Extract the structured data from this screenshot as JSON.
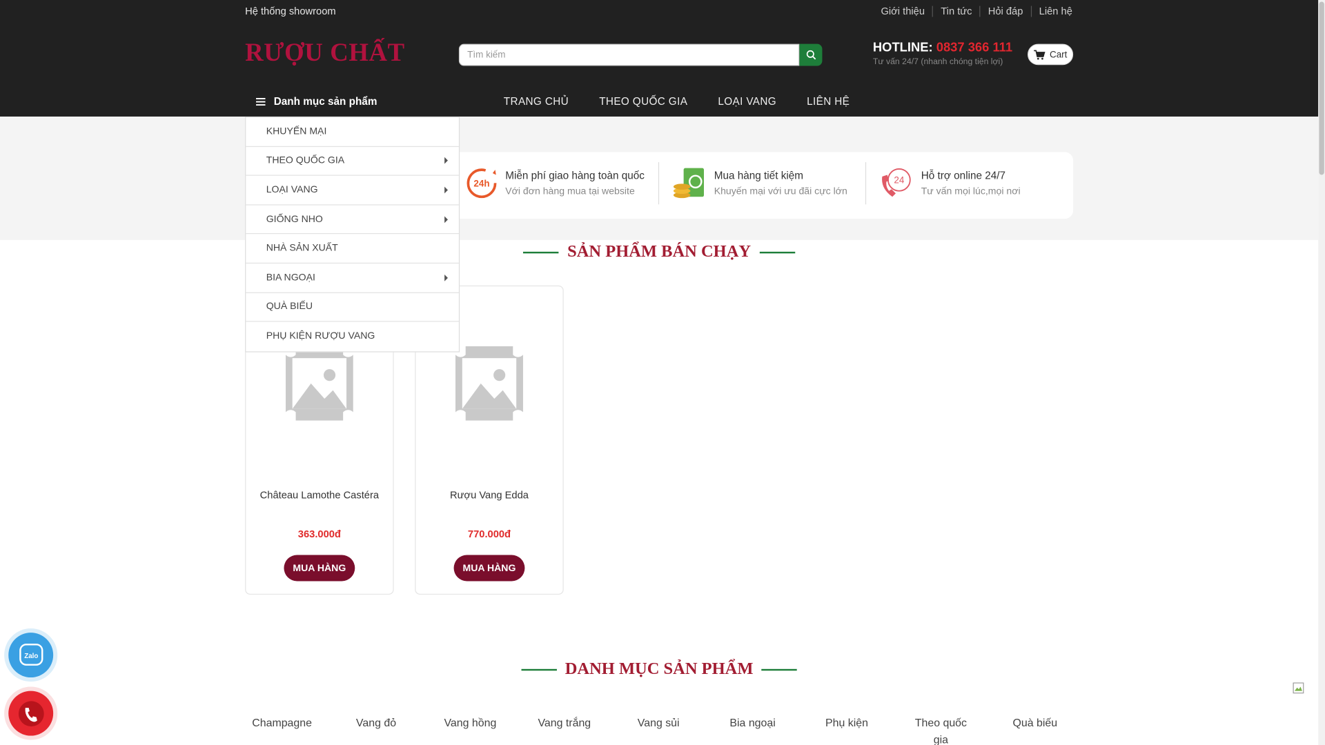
{
  "topbar": {
    "left_link": "Hệ thống showroom",
    "links": [
      "Giới thiệu",
      "Tin tức",
      "Hỏi đáp",
      "Liên hệ"
    ]
  },
  "header": {
    "logo": "RƯỢU CHẤT",
    "search_placeholder": "Tìm kiếm",
    "hotline_label": "HOTLINE:",
    "hotline_number": "0837 366 111",
    "hotline_sub": "Tư vấn 24/7 (nhanh chóng tiện lợi)",
    "cart_label": "Cart"
  },
  "nav": {
    "category_button": "Danh mục sản phẩm",
    "items": [
      "TRANG CHỦ",
      "THEO QUỐC GIA",
      "LOẠI VANG",
      "LIÊN HỆ"
    ]
  },
  "category_dropdown": [
    {
      "label": "KHUYẾN MẠI",
      "has_sub": false
    },
    {
      "label": "THEO QUỐC GIA",
      "has_sub": true
    },
    {
      "label": "LOẠI VANG",
      "has_sub": true
    },
    {
      "label": "GIỐNG NHO",
      "has_sub": true
    },
    {
      "label": "NHÀ SẢN XUẤT",
      "has_sub": false
    },
    {
      "label": "BIA NGOẠI",
      "has_sub": true
    },
    {
      "label": "QUÀ BIẾU",
      "has_sub": false
    },
    {
      "label": "PHỤ KIỆN RƯỢU VANG",
      "has_sub": false
    }
  ],
  "features": [
    {
      "title": "Miễn phí giao hàng toàn quốc",
      "subtitle": "Với đơn hàng mua tại website",
      "icon": "delivery-24h-icon"
    },
    {
      "title": "Mua hàng tiết kiệm",
      "subtitle": "Khuyến mại với ưu đãi cực lớn",
      "icon": "money-coins-icon"
    },
    {
      "title": "Hỗ trợ online 24/7",
      "subtitle": "Tư vấn mọi lúc,mọi nơi",
      "icon": "phone-24-icon"
    }
  ],
  "bestseller": {
    "title": "SẢN PHẨM BÁN CHẠY",
    "products": [
      {
        "name": "Château Lamothe Castéra",
        "price": "363.000đ",
        "button": "MUA HÀNG"
      },
      {
        "name": "Rượu Vang Edda",
        "price": "770.000đ",
        "button": "MUA HÀNG"
      }
    ]
  },
  "categories": {
    "title": "DANH MỤC SẢN PHẨM",
    "items": [
      "Champagne",
      "Vang đỏ",
      "Vang hồng",
      "Vang trắng",
      "Vang sủi",
      "Bia ngoại",
      "Phụ kiện",
      "Theo quốc gia",
      "Quà biếu"
    ]
  },
  "colors": {
    "header_bg": "#212121",
    "brand": "#b0123e",
    "accent_green": "#1e7e3a",
    "price_red": "#e02b2b",
    "button_maroon": "#7a0e2c"
  }
}
